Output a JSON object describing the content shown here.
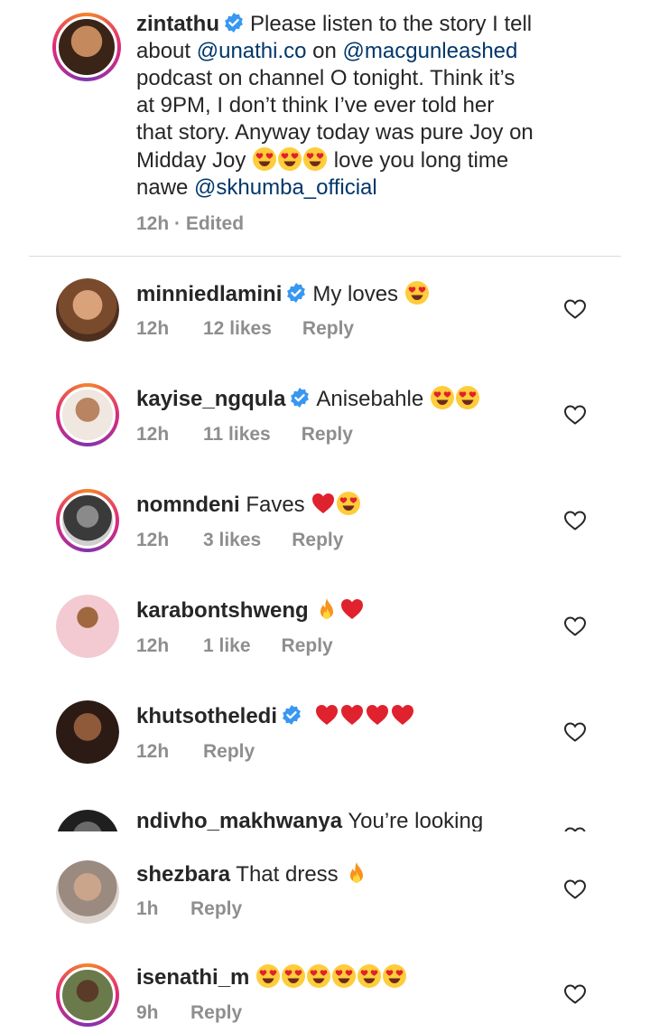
{
  "caption": {
    "username": "zintathu",
    "line1_text": "Please listen to the story I tell",
    "line2_prefix": "about ",
    "line2_mention1": "@unathi.co",
    "line2_mid": " on ",
    "line2_mention2": "@macgunleashed",
    "line3": "podcast on channel O tonight. Think it’s",
    "line4": "at 9PM, I don’t think I’ve ever told her",
    "line5": "that story. Anyway today was pure Joy on",
    "line6_prefix": "Midday Joy ",
    "line6_suffix": " love you long time",
    "line7_prefix": "nawe ",
    "line7_mention": "@skhumba_official",
    "meta": "12h · Edited"
  },
  "comments": [
    {
      "username": "minniedlamini",
      "text": "My loves",
      "time": "12h",
      "likes": "12 likes",
      "reply": "Reply"
    },
    {
      "username": "kayise_ngqula",
      "text": "Anisebahle",
      "time": "12h",
      "likes": "11 likes",
      "reply": "Reply"
    },
    {
      "username": "nomndeni",
      "text": "Faves",
      "time": "12h",
      "likes": "3 likes",
      "reply": "Reply"
    },
    {
      "username": "karabontshweng",
      "text": "",
      "time": "12h",
      "likes": "1 like",
      "reply": "Reply"
    },
    {
      "username": "khutsotheledi",
      "text": "",
      "time": "12h",
      "likes": "",
      "reply": "Reply"
    },
    {
      "username": "ndivho_makhwanya",
      "text": "You’re looking",
      "time": "",
      "likes": "",
      "reply": ""
    },
    {
      "username": "shezbara",
      "text": "That dress",
      "time": "1h",
      "likes": "",
      "reply": "Reply"
    },
    {
      "username": "isenathi_m",
      "text": "",
      "time": "9h",
      "likes": "",
      "reply": "Reply"
    }
  ],
  "icons": {
    "verified": "verified-badge-icon",
    "heart_outline": "heart-outline-icon",
    "heart_eyes": "heart-eyes-emoji",
    "red_heart": "red-heart-emoji",
    "fire": "fire-emoji"
  },
  "colors": {
    "text": "#262626",
    "secondary": "#8e8e8e",
    "mention": "#00376b",
    "verified": "#3897f0",
    "heart_red": "#e0212e",
    "emoji_yellow": "#ffcc3a"
  }
}
